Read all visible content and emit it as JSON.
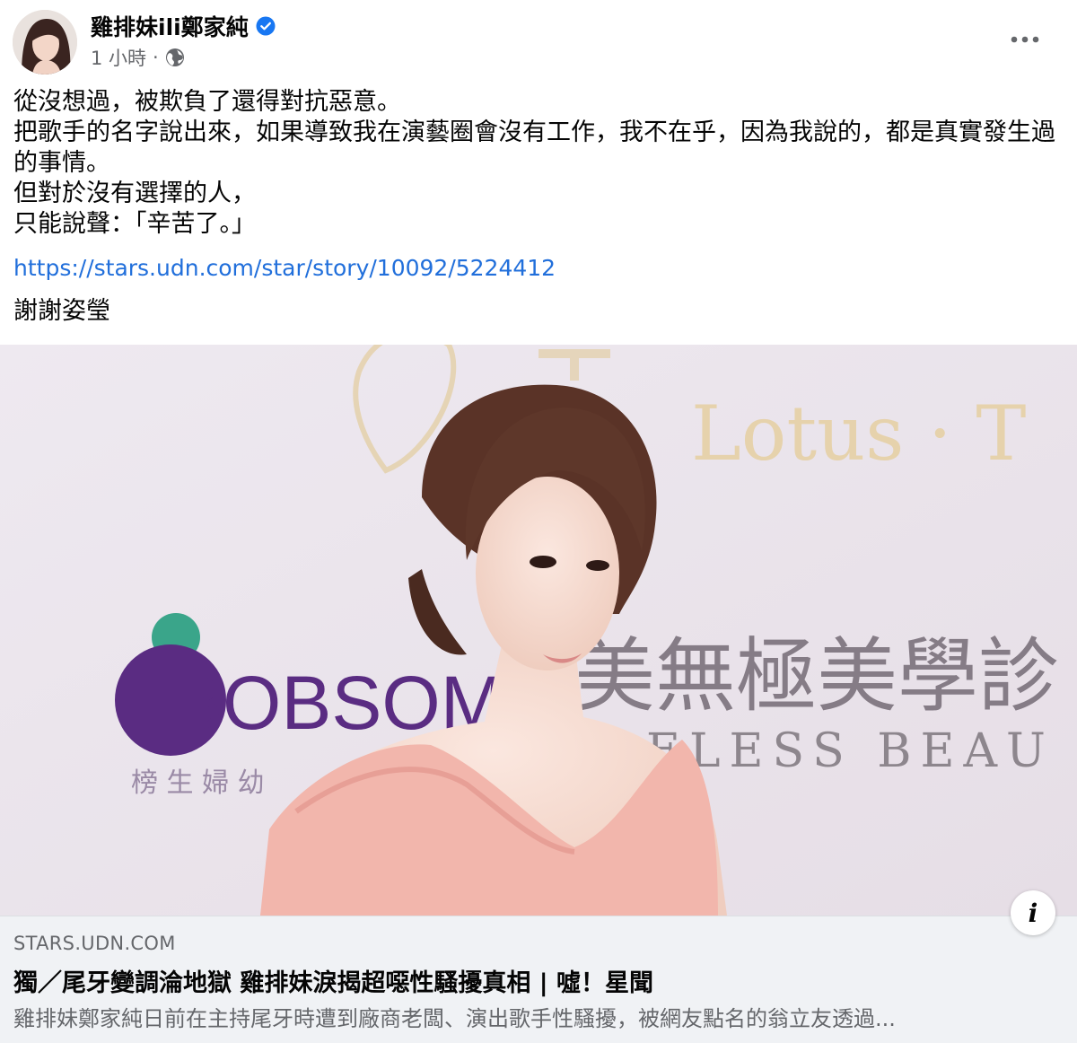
{
  "author": {
    "name": "雞排妹ili鄭家純",
    "verified": true
  },
  "meta": {
    "timestamp": "1 小時",
    "separator": "·",
    "audience_icon": "globe-icon"
  },
  "more_icon": "more-options-icon",
  "post": {
    "lines": [
      "從沒想過，被欺負了還得對抗惡意。",
      "把歌手的名字說出來，如果導致我在演藝圈會沒有工作，我不在乎，因為我說的，都是真實發生過的事情。",
      "但對於沒有選擇的人，",
      "只能說聲：「辛苦了。」"
    ],
    "link": "https://stars.udn.com/star/story/10092/5224412",
    "thanks": "謝謝姿瑩"
  },
  "preview": {
    "domain": "STARS.UDN.COM",
    "title": "獨／尾牙變調淪地獄 雞排妹淚揭超噁性騷擾真相 | 噓！星聞",
    "description": "雞排妹鄭家純日前在主持尾牙時遭到廠商老闆、演出歌手性騷擾，被網友點名的翁立友透過...",
    "info_label": "i",
    "backdrop_text": {
      "logo": "BOBSOM",
      "logo_sub": "榜 生 婦 幼",
      "sponsor_cn": "美無極美學診",
      "sponsor_en": "ELESS BEAU",
      "lotus": "Lotus · T"
    }
  },
  "colors": {
    "link": "#216fdb",
    "secondary_text": "#65676b",
    "verified": "#1877f2",
    "preview_bg": "#f0f2f5"
  }
}
